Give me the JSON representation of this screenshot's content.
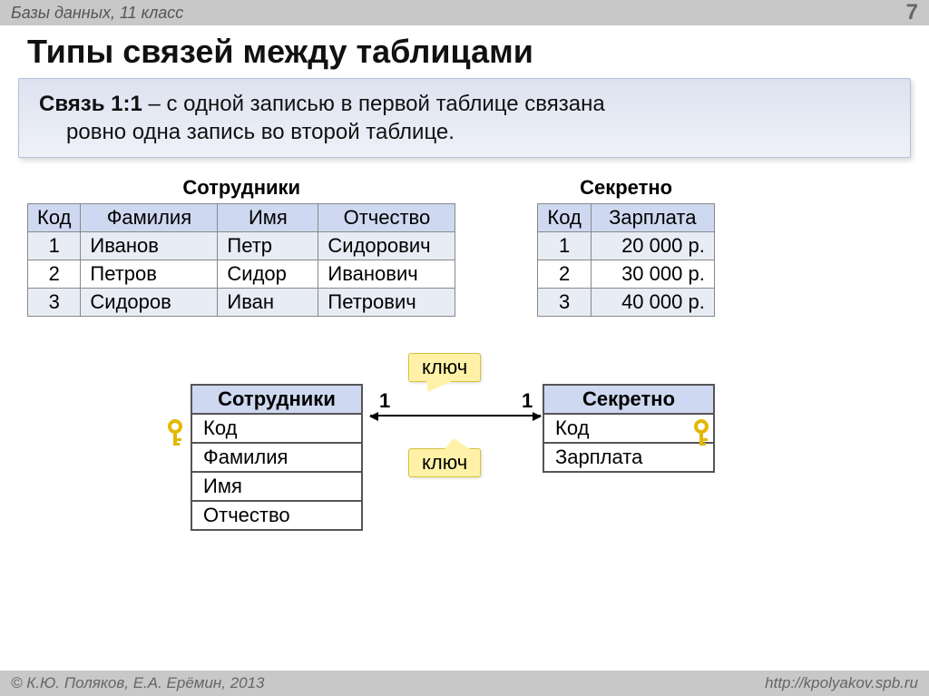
{
  "header": {
    "breadcrumb": "Базы данных, 11 класс",
    "slide_number": "7"
  },
  "title": "Типы связей между таблицами",
  "definition": {
    "term": "Связь 1:1",
    "line1_rest": " – с одной записью в первой таблице связана",
    "line2": "ровно одна запись во второй таблице."
  },
  "employees_table": {
    "caption": "Сотрудники",
    "headers": [
      "Код",
      "Фамилия",
      "Имя",
      "Отчество"
    ],
    "rows": [
      [
        "1",
        "Иванов",
        "Петр",
        "Сидорович"
      ],
      [
        "2",
        "Петров",
        "Сидор",
        "Иванович"
      ],
      [
        "3",
        "Сидоров",
        "Иван",
        "Петрович"
      ]
    ]
  },
  "secret_table": {
    "caption": "Секретно",
    "headers": [
      "Код",
      "Зарплата"
    ],
    "rows": [
      [
        "1",
        "20 000 р."
      ],
      [
        "2",
        "30 000 р."
      ],
      [
        "3",
        "40 000 р."
      ]
    ]
  },
  "schema": {
    "left": {
      "title": "Сотрудники",
      "fields": [
        "Код",
        "Фамилия",
        "Имя",
        "Отчество"
      ]
    },
    "right": {
      "title": "Секретно",
      "fields": [
        "Код",
        "Зарплата"
      ]
    },
    "key_label_top": "ключ",
    "key_label_bottom": "ключ",
    "cardinality_left": "1",
    "cardinality_right": "1"
  },
  "footer": {
    "copyright": "© К.Ю. Поляков, Е.А. Ерёмин, 2013",
    "url": "http://kpolyakov.spb.ru"
  }
}
